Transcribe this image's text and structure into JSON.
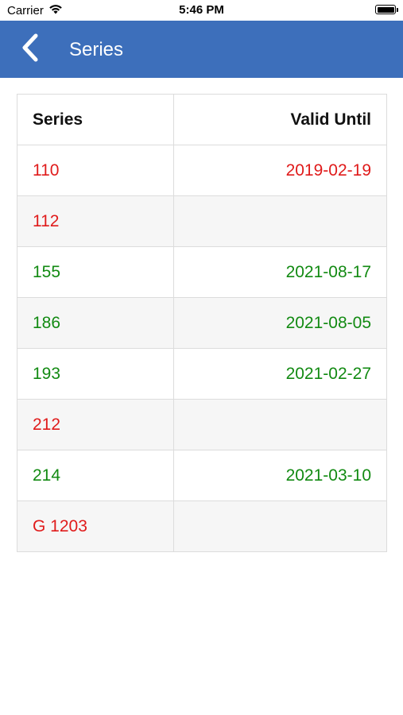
{
  "status_bar": {
    "carrier": "Carrier",
    "time": "5:46 PM",
    "icons": [
      "wifi-icon",
      "battery-icon"
    ]
  },
  "nav": {
    "title": "Series",
    "back_icon": "chevron-left-icon",
    "background_color": "#3d6fbb"
  },
  "colors": {
    "valid": "#128a12",
    "invalid": "#e01b1b"
  },
  "table": {
    "headers": {
      "series": "Series",
      "valid_until": "Valid Until"
    },
    "rows": [
      {
        "series": "110",
        "valid_until": "2019-02-19",
        "status": "invalid"
      },
      {
        "series": "112",
        "valid_until": "",
        "status": "invalid"
      },
      {
        "series": "155",
        "valid_until": "2021-08-17",
        "status": "valid"
      },
      {
        "series": "186",
        "valid_until": "2021-08-05",
        "status": "valid"
      },
      {
        "series": "193",
        "valid_until": "2021-02-27",
        "status": "valid"
      },
      {
        "series": "212",
        "valid_until": "",
        "status": "invalid"
      },
      {
        "series": "214",
        "valid_until": "2021-03-10",
        "status": "valid"
      },
      {
        "series": "G 1203",
        "valid_until": "",
        "status": "invalid"
      }
    ]
  }
}
